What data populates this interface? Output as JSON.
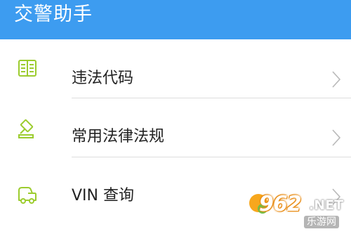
{
  "header": {
    "title": "交警助手"
  },
  "menu": {
    "items": [
      {
        "label": "违法代码",
        "icon": "book-icon"
      },
      {
        "label": "常用法律法规",
        "icon": "gavel-icon"
      },
      {
        "label": "VIN 查询",
        "icon": "truck-icon"
      }
    ]
  },
  "watermark": {
    "brand": "962",
    "tld": ".NET",
    "sub": "乐游网"
  },
  "colors": {
    "header": "#3d9cf0",
    "icon": "#9ccc2e",
    "chevron": "#b9b9b9"
  }
}
